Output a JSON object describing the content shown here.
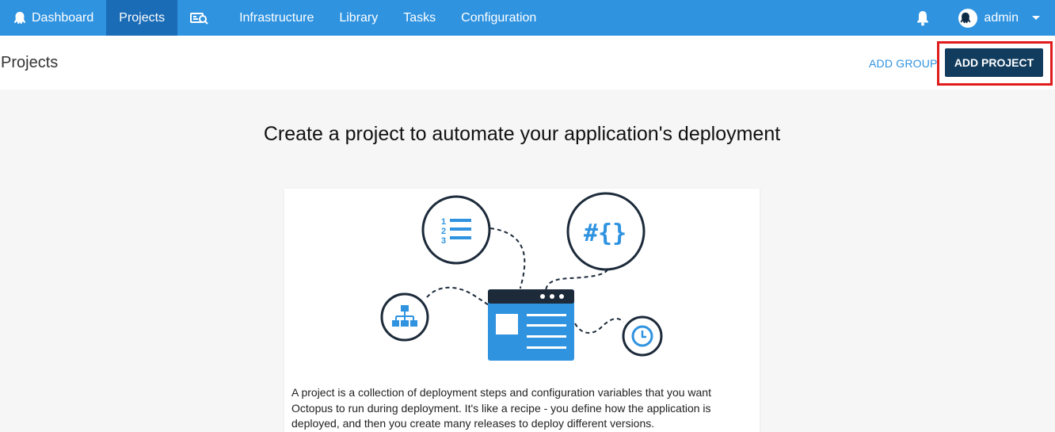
{
  "nav": {
    "items": [
      {
        "label": "Dashboard",
        "icon": "octopus-icon"
      },
      {
        "label": "Projects",
        "active": true
      },
      {
        "label": "",
        "icon": "search-dashboard-icon"
      },
      {
        "label": "Infrastructure"
      },
      {
        "label": "Library"
      },
      {
        "label": "Tasks"
      },
      {
        "label": "Configuration"
      }
    ],
    "user": "admin"
  },
  "header": {
    "title": "Projects",
    "add_group": "ADD GROUP",
    "add_project": "ADD PROJECT"
  },
  "main": {
    "headline": "Create a project to automate your application's deployment",
    "description": "A project is a collection of deployment steps and configuration variables that you want Octopus to run during deployment. It's like a recipe - you define how the application is deployed, and then you create many releases to deploy different versions."
  },
  "colors": {
    "nav_bg": "#2f93e0",
    "nav_active": "#1a6cb6",
    "primary_button": "#113c5e",
    "accent": "#2f93e0",
    "highlight": "#e01b1b"
  }
}
